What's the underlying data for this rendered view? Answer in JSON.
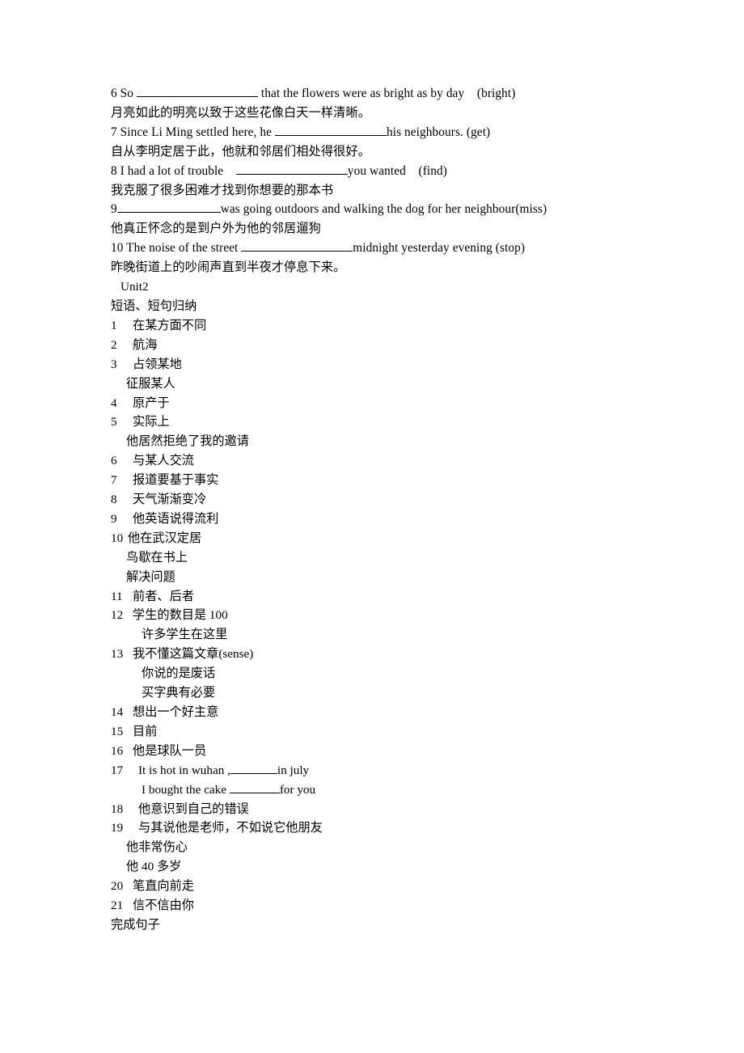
{
  "document": {
    "exercises": [
      {
        "id": "ex-6",
        "en_pre": "6 So ",
        "blank": "w-xl",
        "en_post": " that the flowers were as bright as by day    (bright)",
        "cn": "月亮如此的明亮以致于这些花像白天一样清晰。"
      },
      {
        "id": "ex-7",
        "en_pre": "7 Since Li Ming settled here, he ",
        "blank": "w-lg",
        "en_post": "his neighbours. (get)",
        "cn": "自从李明定居于此，他就和邻居们相处得很好。"
      },
      {
        "id": "ex-8",
        "en_pre": "8 I had a lot of trouble    ",
        "blank": "w-lg",
        "en_post": "you wanted    (find)",
        "cn": "我克服了很多困难才找到你想要的那本书"
      },
      {
        "id": "ex-9",
        "en_pre": "9",
        "blank": "w-md",
        "en_post": "was going outdoors and walking the dog for her neighbour(miss)",
        "cn": "他真正怀念的是到户外为他的邻居遛狗"
      },
      {
        "id": "ex-10",
        "en_pre": "10 The noise of the street ",
        "blank": "w-lg",
        "en_post": "midnight yesterday evening (stop)",
        "cn": "昨晚街道上的吵闹声直到半夜才停息下来。"
      }
    ],
    "unit_title": "Unit2",
    "section_title": "短语、短句归纳",
    "vocab_items": [
      {
        "num": "1",
        "gap": "sp",
        "text": "在某方面不同",
        "subs": []
      },
      {
        "num": "2",
        "gap": "sp",
        "text": "航海",
        "subs": []
      },
      {
        "num": "3",
        "gap": "sp",
        "text": "占领某地",
        "subs": [
          {
            "indent": "i1",
            "text": "征服某人"
          }
        ]
      },
      {
        "num": "4",
        "gap": "sp",
        "text": "原产于",
        "subs": []
      },
      {
        "num": "5",
        "gap": "sp",
        "text": "实际上",
        "subs": [
          {
            "indent": "i1",
            "text": "他居然拒绝了我的邀请"
          }
        ]
      },
      {
        "num": "6",
        "gap": "sp",
        "text": "与某人交流",
        "subs": []
      },
      {
        "num": "7",
        "gap": "sp",
        "text": "报道要基于事实",
        "subs": []
      },
      {
        "num": "8",
        "gap": "sp",
        "text": "天气渐渐变冷",
        "subs": []
      },
      {
        "num": "9",
        "gap": "sp",
        "text": "他英语说得流利",
        "subs": []
      },
      {
        "num": "10",
        "gap": "none",
        "text": "他在武汉定居",
        "subs": [
          {
            "indent": "i1",
            "text": "鸟歇在书上"
          },
          {
            "indent": "i1",
            "text": "解决问题"
          }
        ]
      },
      {
        "num": "11",
        "gap": "sp",
        "text": "前者、后者",
        "subs": []
      },
      {
        "num": "12",
        "gap": "sp",
        "text": "学生的数目是 100",
        "subs": [
          {
            "indent": "i2",
            "text": "许多学生在这里"
          }
        ]
      },
      {
        "num": "13",
        "gap": "sp",
        "text": "我不懂这篇文章(sense)",
        "subs": [
          {
            "indent": "i2",
            "text": "你说的是废话"
          },
          {
            "indent": "i2",
            "text": "买字典有必要"
          }
        ]
      },
      {
        "num": "14",
        "gap": "sp",
        "text": "想出一个好主意",
        "subs": []
      },
      {
        "num": "15",
        "gap": "sp",
        "text": "目前",
        "subs": []
      },
      {
        "num": "16",
        "gap": "sp",
        "text": "他是球队一员",
        "subs": []
      },
      {
        "num": "18",
        "gap": "wide",
        "text": "他意识到自己的错误",
        "subs": []
      },
      {
        "num": "19",
        "gap": "wide",
        "text": "与其说他是老师，不如说它他朋友",
        "subs": [
          {
            "indent": "i1",
            "text": "他非常伤心"
          },
          {
            "indent": "i1",
            "text": "他 40 多岁"
          }
        ]
      },
      {
        "num": "20",
        "gap": "sp",
        "text": "笔直向前走",
        "subs": []
      },
      {
        "num": "21",
        "gap": "sp",
        "text": "信不信由你",
        "subs": []
      }
    ],
    "item17": {
      "num": "17",
      "line_a_pre": "It is hot in wuhan ,",
      "line_a_blank": "w-xs",
      "line_a_post": "in july",
      "line_b_pre": "I bought the cake ",
      "line_b_blank": "w-sm",
      "line_b_post": "for you"
    },
    "closing": "完成句子"
  }
}
